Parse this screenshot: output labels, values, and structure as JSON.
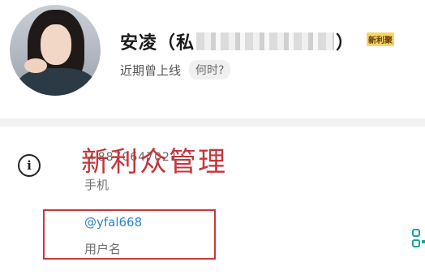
{
  "profile": {
    "name_prefix": "安凌（私",
    "name_suffix": "）",
    "badge": "新利聚",
    "status": "近期曾上线",
    "status_pill": "何时?"
  },
  "info": {
    "watermark": "新利众管理",
    "phone_value": "+8870647021",
    "phone_label": "手机",
    "username_value": "@yfal668",
    "username_label": "用户名"
  },
  "icons": {
    "info": "info-icon",
    "qr": "qr-code-icon"
  },
  "colors": {
    "highlight": "#c9383c",
    "link": "#2a86c4"
  }
}
